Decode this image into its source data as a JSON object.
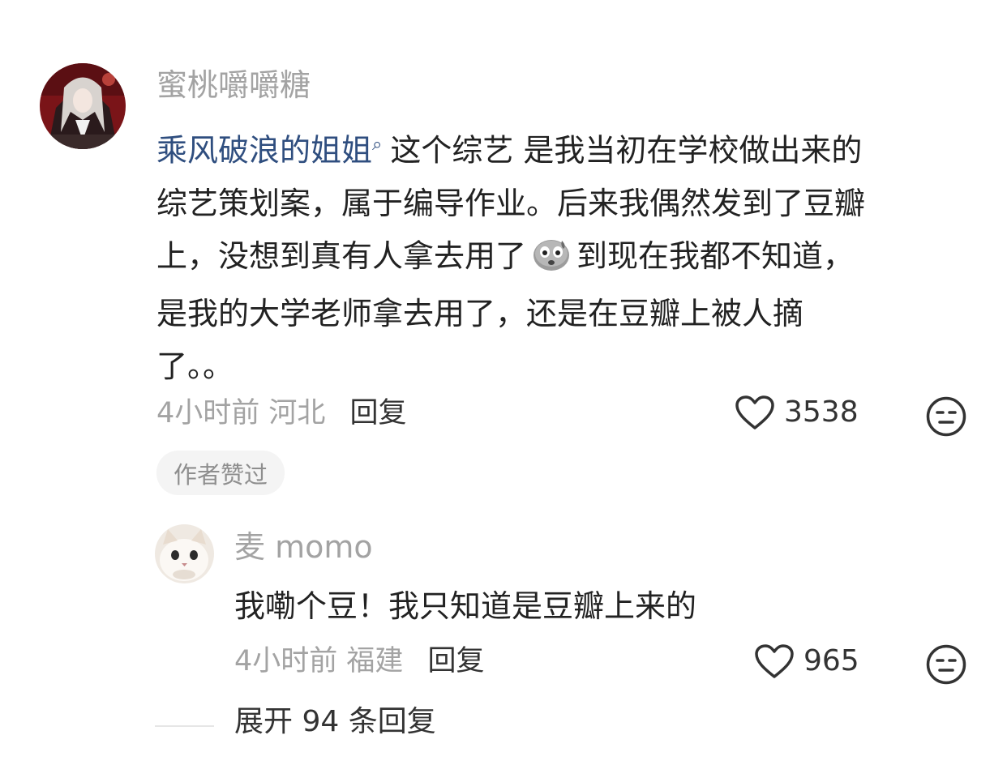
{
  "comment": {
    "username": "蜜桃嚼嚼糖",
    "topic_link": "乘风破浪的姐姐",
    "lines": [
      "这个综艺 是我当初在学校做出来的",
      "综艺策划案，属于编导作业。后来我偶然发到了豆瓣",
      "上，没想到真有人拿去用了",
      "到现在我都不知道，",
      "是我的大学老师拿去用了，还是在豆瓣上被人摘",
      "了。。"
    ],
    "time": "4小时前",
    "location": "河北",
    "reply_label": "回复",
    "like_count": "3538",
    "author_liked_badge": "作者赞过",
    "icons": {
      "topic_mark": "search-icon",
      "emoji": "sweating-potato-emoji",
      "like": "heart-outline-icon",
      "dislike": "expressionless-face-icon"
    }
  },
  "reply": {
    "username": "麦 momo",
    "text": "我嘞个豆！我只知道是豆瓣上来的",
    "time": "4小时前",
    "location": "福建",
    "reply_label": "回复",
    "like_count": "965"
  },
  "expand_label": "展开 94 条回复",
  "colors": {
    "username": "#a3a3a3",
    "topic_link": "#2f4e7f",
    "body_text": "#222222",
    "meta": "#a3a3a3",
    "badge_bg": "#f4f4f4"
  }
}
